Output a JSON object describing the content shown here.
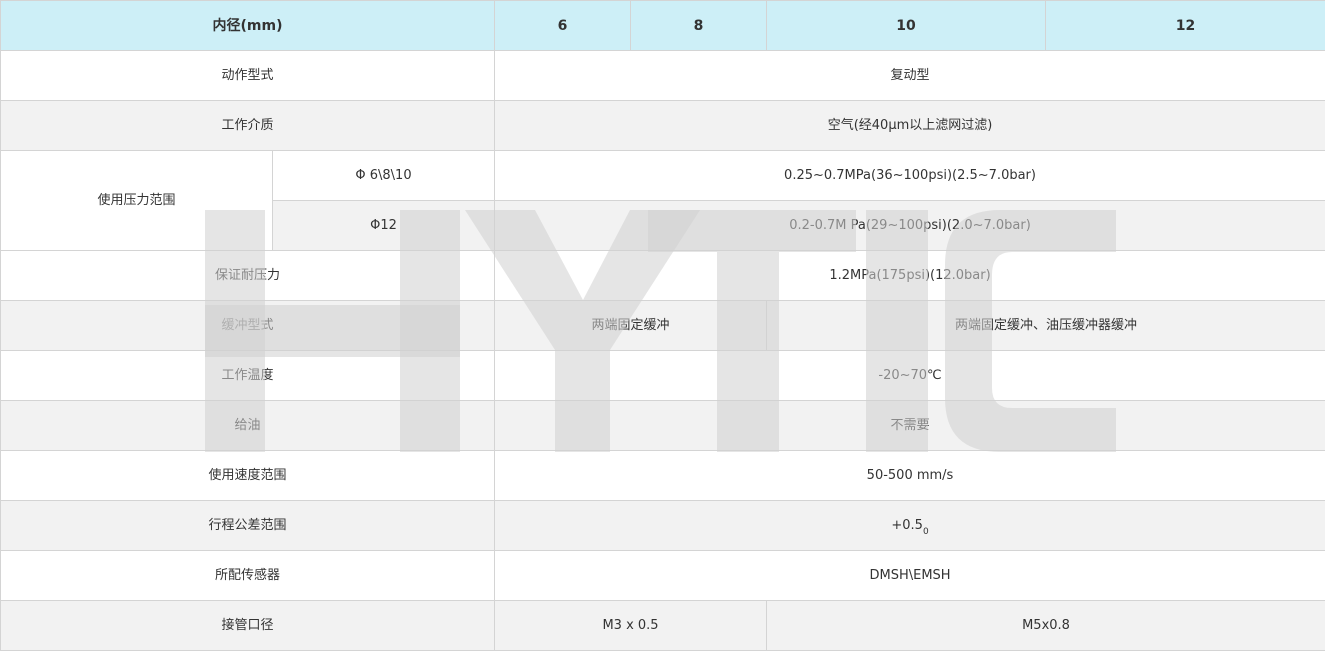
{
  "colors": {
    "header_bg": "#cdeff7",
    "row_alt_bg": "#f2f2f2",
    "border": "#d4d4d4",
    "watermark": "#dcdcdc"
  },
  "watermark_text": "HYTIC",
  "header": {
    "label": "内径(mm)",
    "bores": [
      "6",
      "8",
      "10",
      "12"
    ]
  },
  "rows": {
    "action_type": {
      "label": "动作型式",
      "value": "复动型"
    },
    "medium": {
      "label": "工作介质",
      "value": "空气(经40μm以上滤网过滤)"
    },
    "pressure": {
      "label": "使用压力范围",
      "sub1": {
        "label": "Φ 6\\8\\10",
        "value": "0.25~0.7MPa(36~100psi)(2.5~7.0bar)"
      },
      "sub2": {
        "label": "Φ12",
        "value": "0.2-0.7M Pa(29~100psi)(2.0~7.0bar)"
      }
    },
    "proof_pressure": {
      "label": "保证耐压力",
      "value": "1.2MPa(175psi)(12.0bar)"
    },
    "cushion": {
      "label": "缓冲型式",
      "value_small": "两端固定缓冲",
      "value_large": "两端固定缓冲、油压缓冲器缓冲"
    },
    "temperature": {
      "label": "工作温度",
      "value": "-20~70℃"
    },
    "lubrication": {
      "label": "给油",
      "value": "不需要"
    },
    "speed": {
      "label": "使用速度范围",
      "value": "50-500 mm/s"
    },
    "stroke_tolerance": {
      "label": "行程公差范围",
      "value": "+0.5",
      "value_sub": "0"
    },
    "sensor": {
      "label": "所配传感器",
      "value": "DMSH\\EMSH"
    },
    "port": {
      "label": "接管口径",
      "value_small": "M3 x 0.5",
      "value_large": "M5x0.8"
    }
  }
}
